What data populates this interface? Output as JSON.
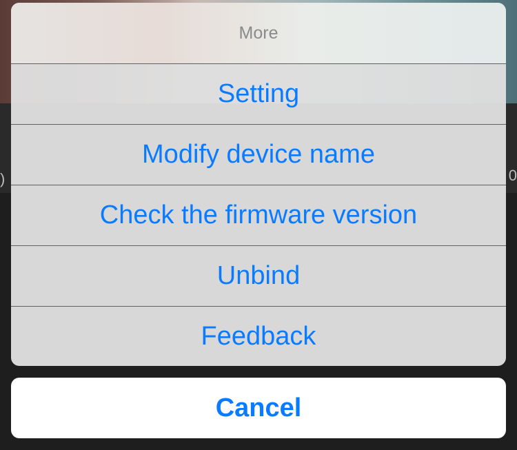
{
  "background": {
    "left_edge_text": ")",
    "right_edge_text": "0"
  },
  "action_sheet": {
    "title": "More",
    "actions": [
      {
        "label": "Setting"
      },
      {
        "label": "Modify device name"
      },
      {
        "label": "Check the firmware version"
      },
      {
        "label": "Unbind"
      },
      {
        "label": "Feedback"
      }
    ],
    "cancel_label": "Cancel"
  },
  "colors": {
    "accent": "#0a7bff",
    "sheet_bg": "#e0e0e0",
    "title_text": "#8a8a8a",
    "separator": "#5f5f5f",
    "cancel_bg": "#ffffff"
  }
}
